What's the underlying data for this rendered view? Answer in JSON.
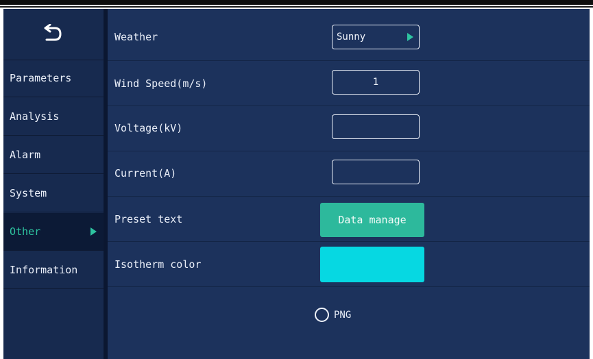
{
  "sidebar": {
    "back_icon": "back-arrow-icon",
    "items": [
      {
        "label": "Parameters"
      },
      {
        "label": "Analysis"
      },
      {
        "label": "Alarm"
      },
      {
        "label": "System"
      },
      {
        "label": "Other",
        "active": true
      },
      {
        "label": "Information"
      }
    ]
  },
  "settings": {
    "weather": {
      "label": "Weather",
      "value": "Sunny"
    },
    "wind_speed": {
      "label": "Wind Speed(m/s)",
      "value": "1"
    },
    "voltage": {
      "label": "Voltage(kV)",
      "value": ""
    },
    "current": {
      "label": "Current(A)",
      "value": ""
    },
    "preset_text": {
      "label": "Preset text",
      "button": "Data manage"
    },
    "isotherm_color": {
      "label": "Isotherm color",
      "color": "#06d8e2"
    },
    "format": {
      "option": "PNG",
      "selected": false
    }
  },
  "colors": {
    "accent": "#2ec4a0",
    "background": "#1c325c"
  }
}
